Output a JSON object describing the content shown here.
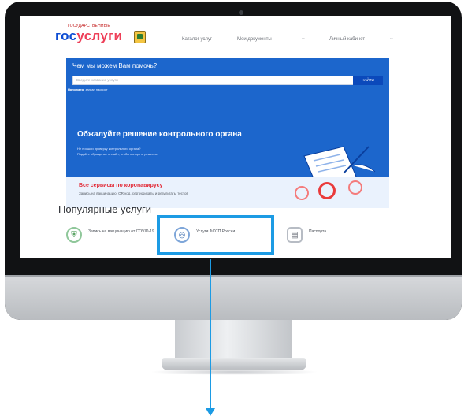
{
  "header": {
    "logo_small": "ГОСУДАРСТВЕННЫЕ",
    "logo_part1": "гос",
    "logo_part2": "услуги",
    "nav": [
      "Каталог услуг",
      "Мои документы",
      "Личный кабинет"
    ]
  },
  "hero": {
    "title": "Чем мы можем Вам помочь?",
    "search_placeholder": "Введите название услуги",
    "search_button": "НАЙТИ",
    "example_label": "Например:",
    "example_value": "загран паспорт"
  },
  "promo": {
    "title": "Обжалуйте решение контрольного органа",
    "line1": "Не прошли проверку контрольного органа?",
    "line2": "Подайте обращение онлайн, чтобы оспорить решение"
  },
  "covid": {
    "title": "Все сервисы по коронавирусу",
    "subtitle": "Запись на вакцинацию, QR-код, сертификаты и результаты тестов"
  },
  "popular": {
    "title": "Популярные услуги",
    "services": [
      {
        "icon": "shield-icon",
        "label": "Запись на вакцинацию от COVID-19"
      },
      {
        "icon": "emblem-icon",
        "label": "Услуги ФССП России"
      },
      {
        "icon": "passport-icon",
        "label": "Паспорта"
      }
    ]
  },
  "colors": {
    "accent_blue": "#1c66cc",
    "highlight": "#1c9be4",
    "covid_red": "#e22c38"
  }
}
